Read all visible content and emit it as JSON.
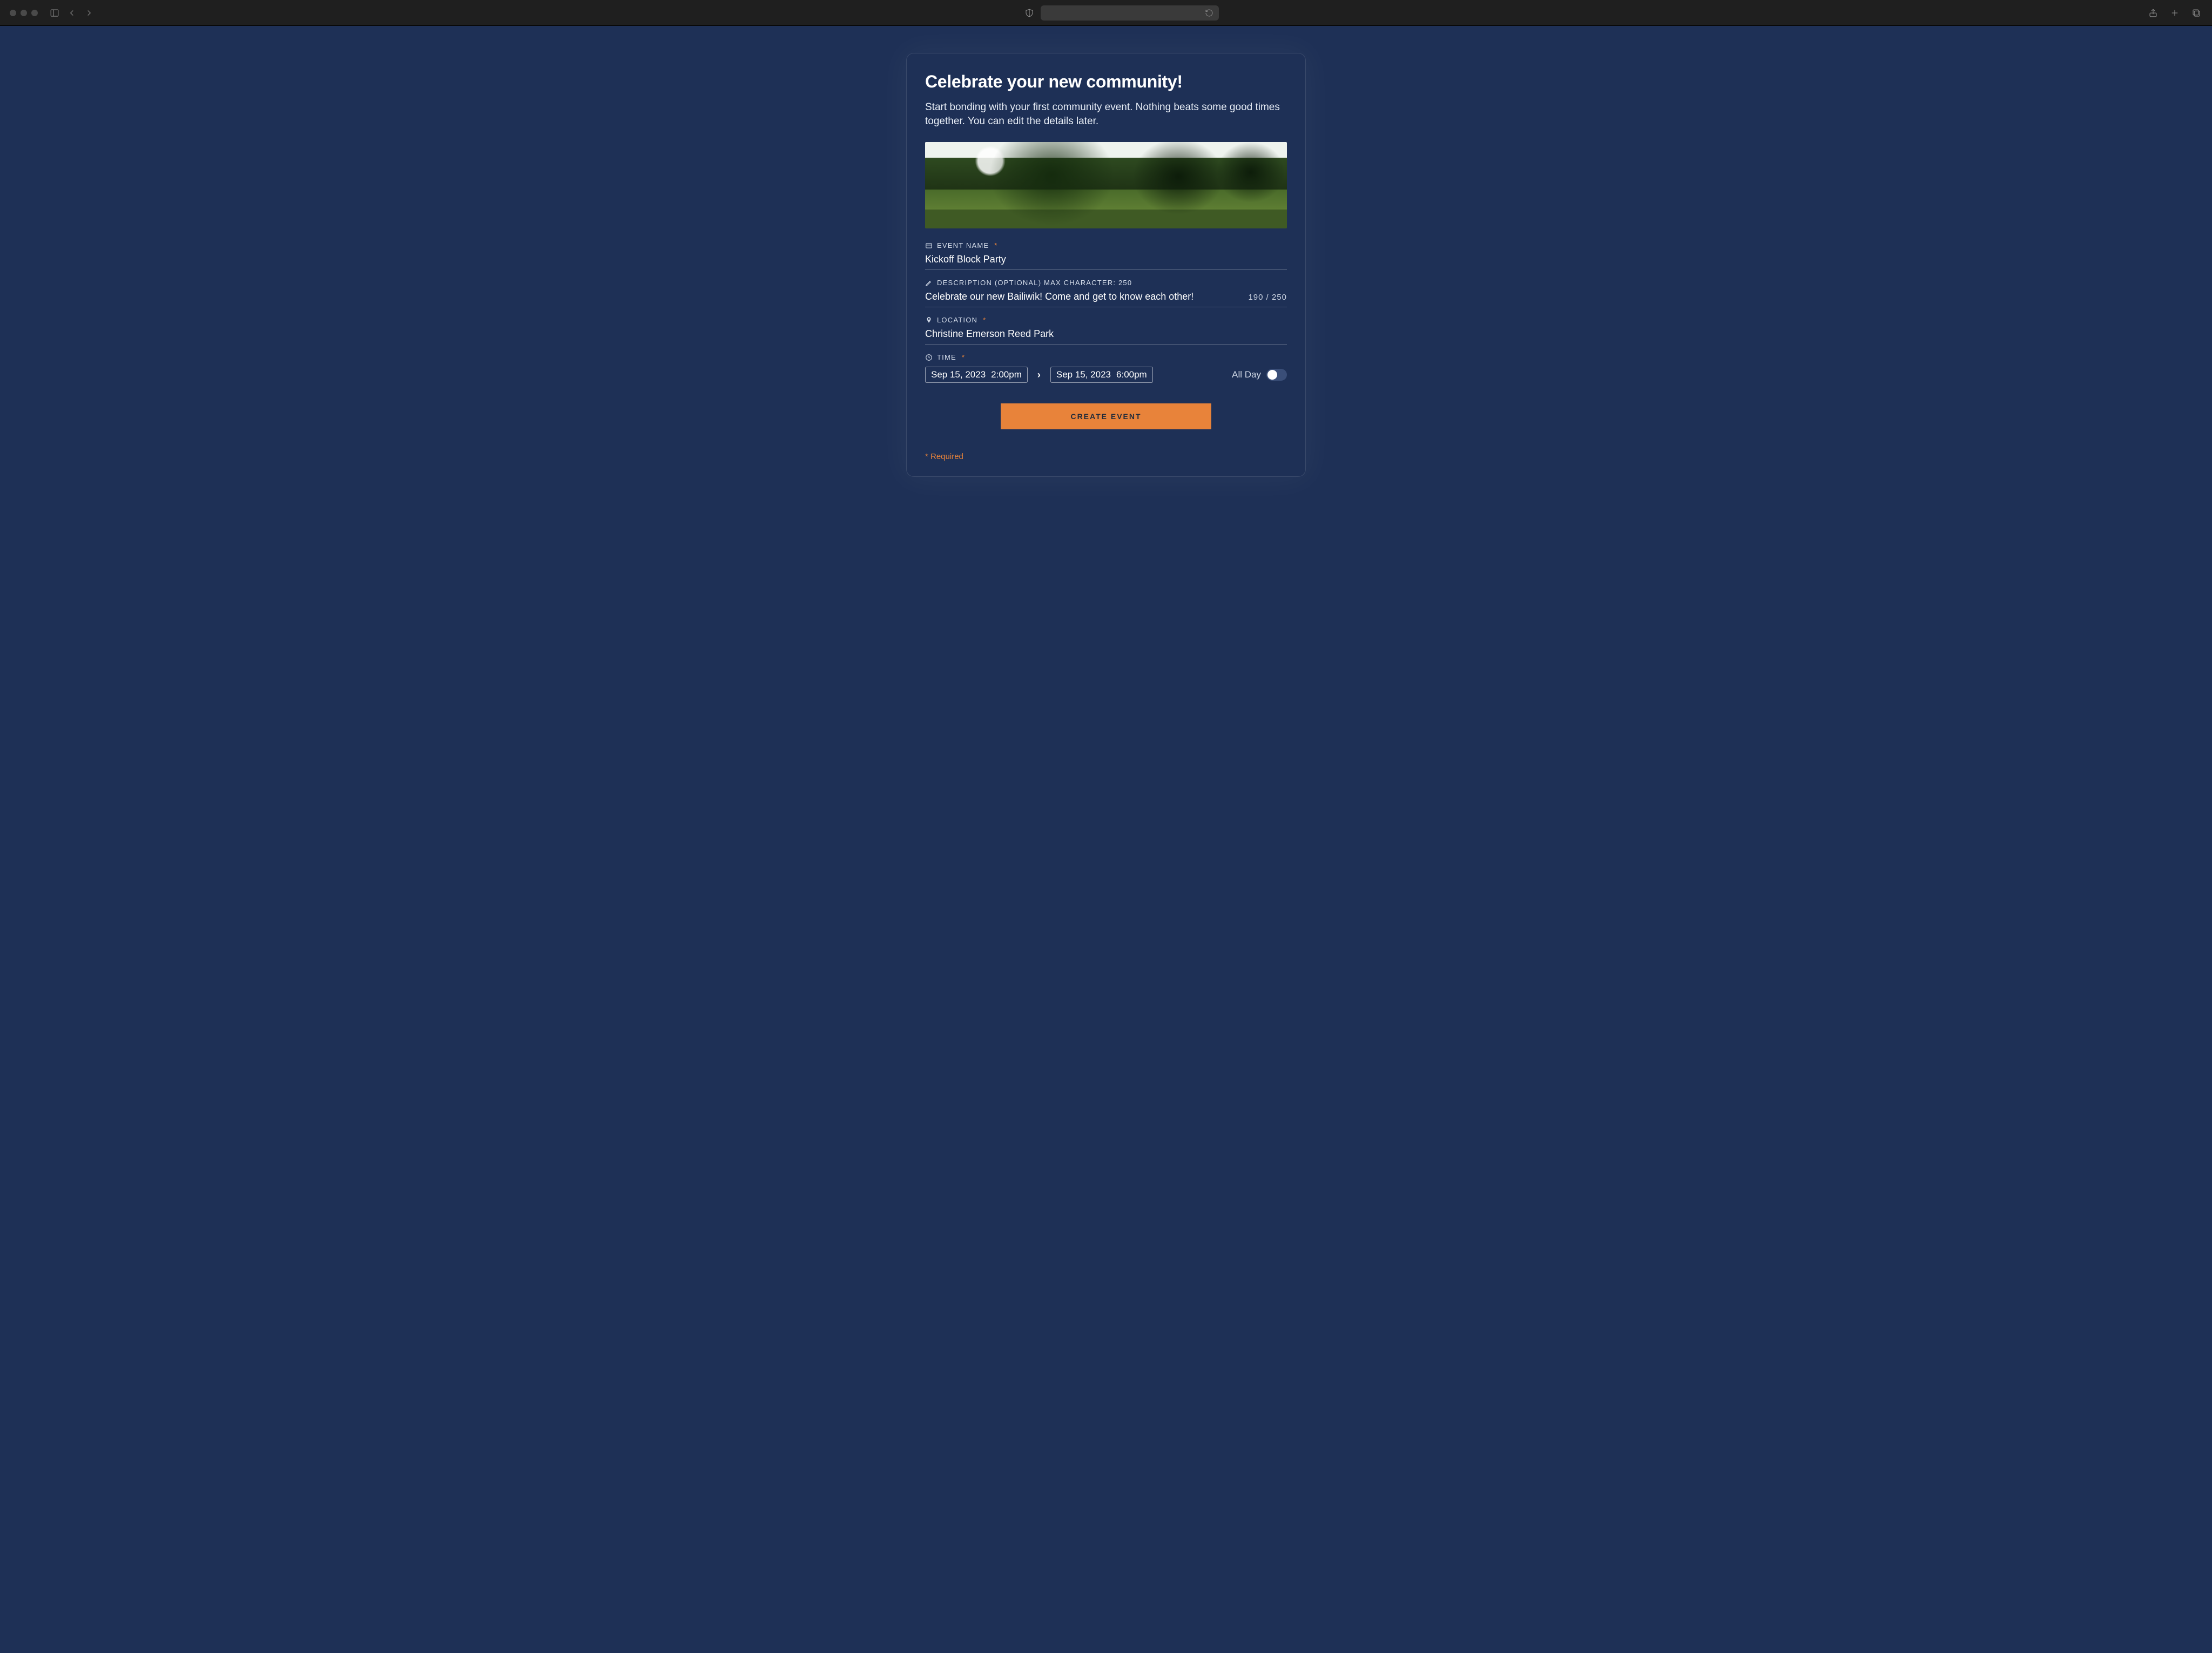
{
  "colors": {
    "accent": "#e8833a",
    "bg": "#1e3056"
  },
  "header": {
    "title": "Celebrate your new community!",
    "subtitle": "Start bonding with your first community event. Nothing beats some good times together. You can edit the details later."
  },
  "fields": {
    "event_name": {
      "label": "EVENT NAME",
      "required_mark": "*",
      "value": "Kickoff Block Party"
    },
    "description": {
      "label": "DESCRIPTION (OPTIONAL) MAX CHARACTER: 250",
      "value": "Celebrate our new Bailiwik! Come and get to know each other!",
      "count": "190 / 250"
    },
    "location": {
      "label": "LOCATION",
      "required_mark": "*",
      "value": "Christine Emerson Reed Park"
    },
    "time": {
      "label": "TIME",
      "required_mark": "*",
      "start": {
        "date": "Sep 15, 2023",
        "time": "2:00pm"
      },
      "end": {
        "date": "Sep 15, 2023",
        "time": "6:00pm"
      },
      "all_day_label": "All Day",
      "all_day_on": false
    }
  },
  "actions": {
    "create_label": "CREATE EVENT"
  },
  "footer": {
    "required_note": "* Required"
  }
}
